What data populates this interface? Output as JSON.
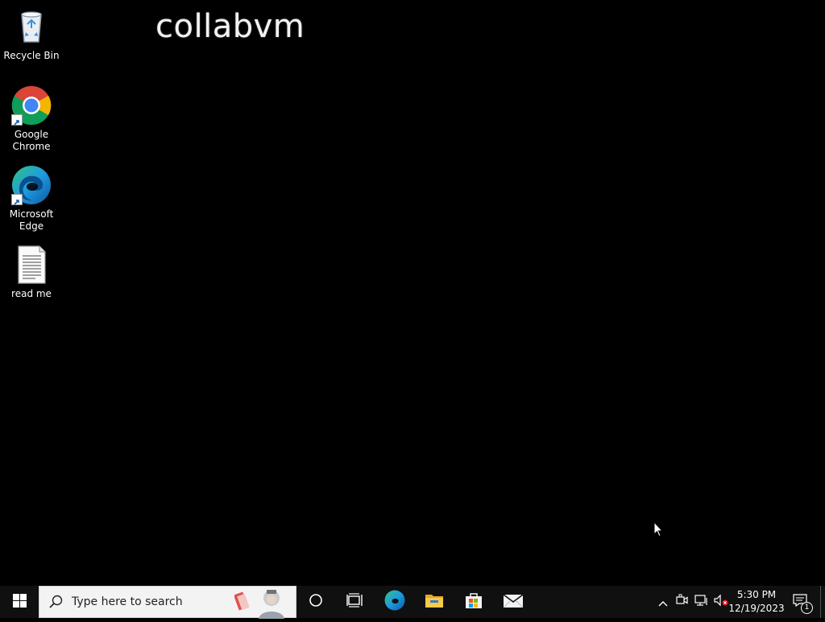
{
  "watermark": "collabvm",
  "desktop_icons": [
    {
      "label": "Recycle Bin",
      "icon": "recycle-bin-icon"
    },
    {
      "label": "Google\nChrome",
      "icon": "chrome-icon"
    },
    {
      "label": "Microsoft\nEdge",
      "icon": "edge-icon"
    },
    {
      "label": "read me",
      "icon": "text-file-icon"
    }
  ],
  "taskbar": {
    "search_placeholder": "Type here to search",
    "pinned": [
      "cortana-icon",
      "task-view-icon",
      "edge-icon",
      "file-explorer-icon",
      "store-icon",
      "mail-icon"
    ],
    "tray_icons": [
      "chevron-up-icon",
      "meet-now-icon",
      "network-icon",
      "volume-muted-icon"
    ],
    "time": "5:30 PM",
    "date": "12/19/2023",
    "notifications_count": "1"
  },
  "colors": {
    "desktop_bg": "#000000",
    "taskbar_bg": "#101010",
    "search_bg": "#f3f3f3"
  }
}
